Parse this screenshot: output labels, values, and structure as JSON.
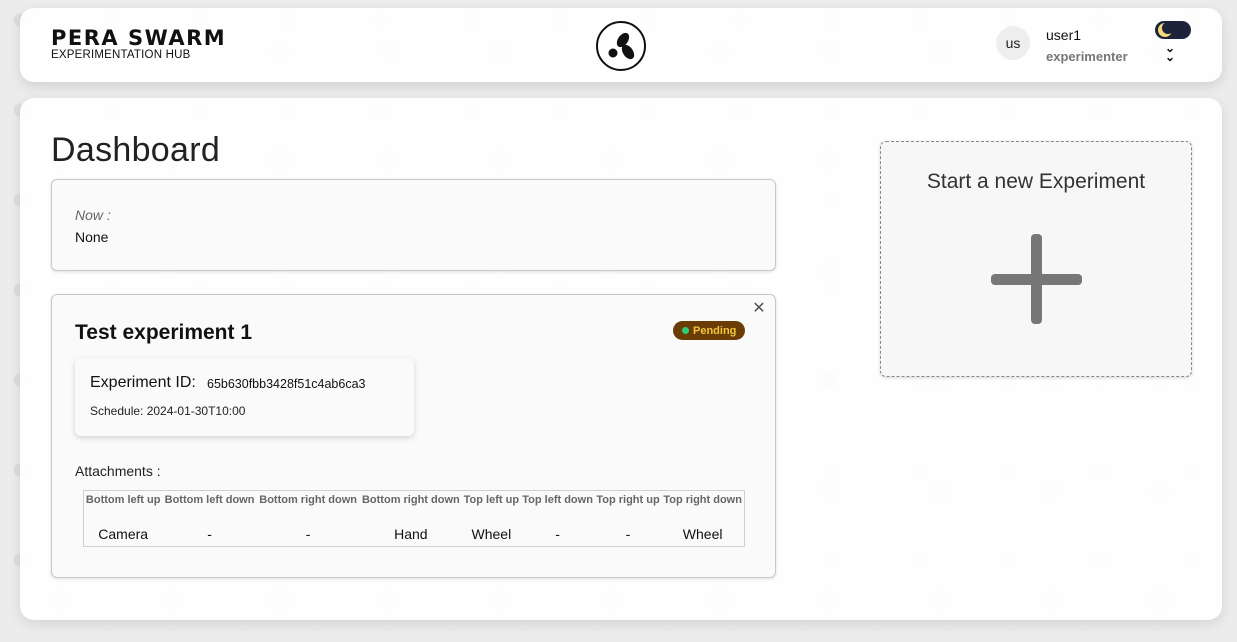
{
  "header": {
    "brand_title": "PERA SWARM",
    "brand_subtitle": "EXPERIMENTATION HUB",
    "logo_icon": "swarm-logo-icon",
    "avatar_initials": "us",
    "user_name": "user1",
    "user_role": "experimenter",
    "theme_toggle_icon": "moon-icon",
    "menu_chevron": "»"
  },
  "dashboard": {
    "title": "Dashboard",
    "now_label": "Now :",
    "now_value": "None"
  },
  "experiment": {
    "title": "Test experiment 1",
    "status": "Pending",
    "status_color": "#6b3d06",
    "status_text_color": "#f2c53d",
    "status_dot_color": "#2ecc71",
    "id_label": "Experiment ID:",
    "id_value": "65b630fbb3428f51c4ab6ca3",
    "schedule": "Schedule: 2024-01-30T10:00",
    "attachments_label": "Attachments :",
    "attachments": {
      "headers": [
        "Bottom left up",
        "Bottom left down",
        "Bottom right down",
        "Bottom right down",
        "Top left up",
        "Top left down",
        "Top right up",
        "Top right down"
      ],
      "values": [
        "Camera",
        "-",
        "-",
        "Hand",
        "Wheel",
        "-",
        "-",
        "Wheel"
      ]
    }
  },
  "new_experiment": {
    "title": "Start a new Experiment",
    "icon": "plus-icon"
  }
}
